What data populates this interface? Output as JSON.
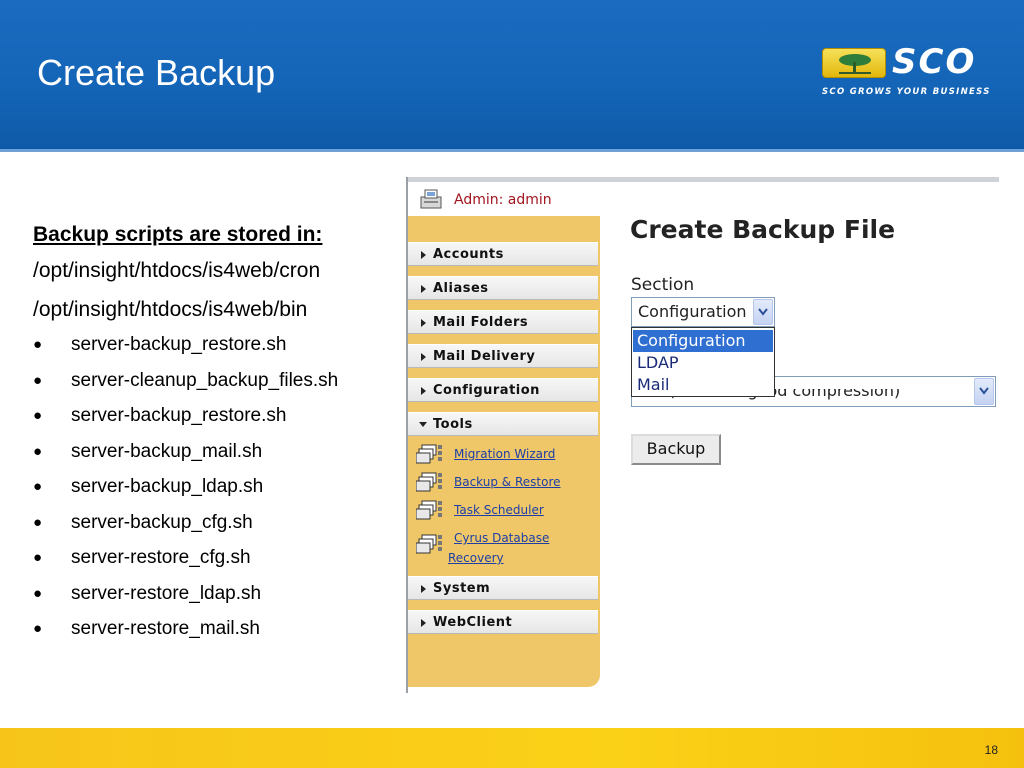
{
  "slide": {
    "title": "Create Backup",
    "page_number": "18"
  },
  "logo": {
    "wordmark": "SCO",
    "tagline": "SCO GROWS YOUR BUSINESS",
    "color_brand_yellow": "#f3cc2a"
  },
  "content": {
    "lead": "Backup scripts are stored in:",
    "paths": [
      "/opt/insight/htdocs/is4web/cron",
      "/opt/insight/htdocs/is4web/bin"
    ],
    "bullets": [
      "server-backup_restore.sh",
      "server-cleanup_backup_files.sh",
      "server-backup_restore.sh",
      "server-backup_mail.sh",
      "server-backup_ldap.sh",
      "server-backup_cfg.sh",
      "server-restore_cfg.sh",
      "server-restore_ldap.sh",
      "server-restore_mail.sh"
    ]
  },
  "screenshot": {
    "admin_label": "Admin: admin",
    "nav": {
      "accounts": "Accounts",
      "aliases": "Aliases",
      "mail_folders": "Mail Folders",
      "mail_delivery": "Mail Delivery",
      "configuration": "Configuration",
      "tools": "Tools",
      "system": "System",
      "webclient": "WebClient"
    },
    "tools": {
      "migration_wizard": "Migration Wizard",
      "backup_restore": "Backup & Restore",
      "task_scheduler": "Task Scheduler",
      "cyrus_line1": "Cyrus Database",
      "cyrus_line2": "Recovery"
    },
    "form": {
      "title": "Create Backup File",
      "section_label": "Section",
      "section_value": "Configuration",
      "section_options": [
        "Configuration",
        "LDAP",
        "Mail"
      ],
      "compression_value": "Yes (slow but good compression)",
      "backup_button": "Backup"
    },
    "colors": {
      "sidebar": "#efc768",
      "admin_text": "#a2151f",
      "link": "#1d3fa6",
      "selected_option": "#2f6fd1"
    }
  },
  "colors": {
    "header_blue": "#1465b8",
    "footer_yellow": "#fbd117"
  }
}
